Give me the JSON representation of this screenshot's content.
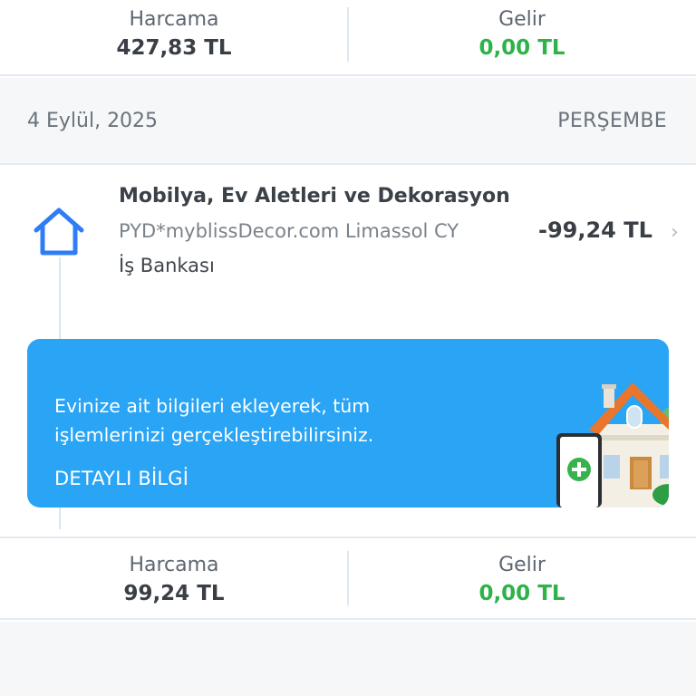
{
  "top_summary": {
    "expense_label": "Harcama",
    "expense_value": "427,83 TL",
    "income_label": "Gelir",
    "income_value": "0,00 TL"
  },
  "date_header": {
    "date": "4 Eylül, 2025",
    "weekday": "PERŞEMBE"
  },
  "transaction": {
    "category": "Mobilya, Ev Aletleri ve Dekorasyon",
    "merchant": "PYD*myblissDecor.com Limassol CY",
    "bank": "İş Bankası",
    "amount": "-99,24 TL",
    "icon": "home-icon"
  },
  "banner": {
    "message": "Evinize ait bilgileri ekleyerek, tüm işlemlerinizi gerçekleştirebilirsiniz.",
    "link_label": "DETAYLI BİLGİ",
    "background": "#2aa4f4"
  },
  "bottom_summary": {
    "expense_label": "Harcama",
    "expense_value": "99,24 TL",
    "income_label": "Gelir",
    "income_value": "0,00 TL"
  },
  "colors": {
    "income_green": "#2fb24a",
    "icon_blue": "#2f7df6"
  }
}
